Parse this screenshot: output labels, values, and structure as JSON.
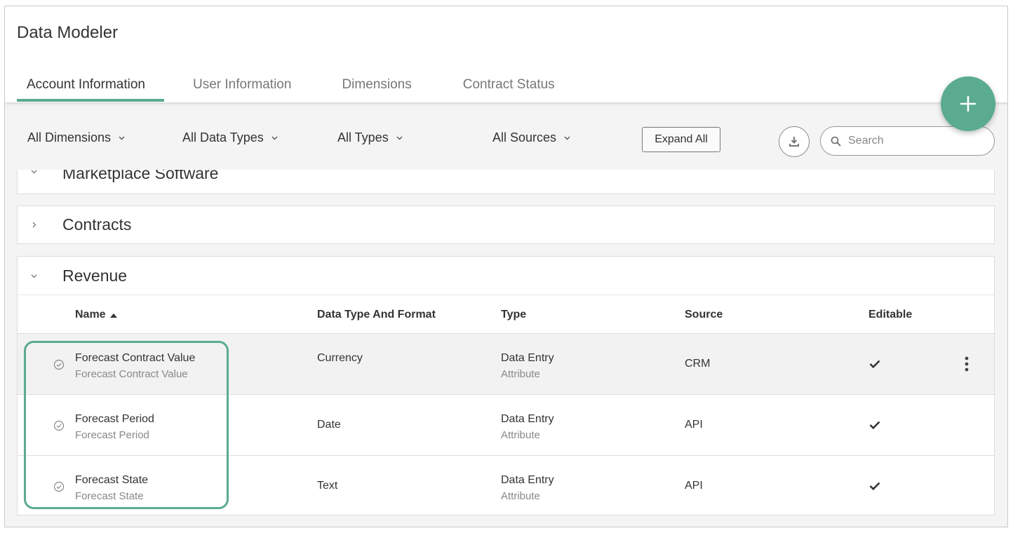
{
  "app": {
    "title": "Data Modeler"
  },
  "tabs": [
    {
      "label": "Account Information",
      "active": true
    },
    {
      "label": "User Information",
      "active": false
    },
    {
      "label": "Dimensions",
      "active": false
    },
    {
      "label": "Contract Status",
      "active": false
    }
  ],
  "fab": {
    "icon": "plus-icon"
  },
  "filters": {
    "dimensions": "All Dimensions",
    "data_types": "All Data Types",
    "types": "All Types",
    "sources": "All Sources",
    "expand_all": "Expand All",
    "download_icon": "download-icon",
    "search_placeholder": "Search"
  },
  "sections": {
    "marketplace": {
      "title": "Marketplace Software",
      "expanded": true
    },
    "contracts": {
      "title": "Contracts",
      "expanded": false
    },
    "revenue": {
      "title": "Revenue",
      "expanded": true
    }
  },
  "table": {
    "columns": {
      "name": "Name",
      "dtype": "Data Type And Format",
      "type": "Type",
      "source": "Source",
      "editable": "Editable"
    },
    "rows": [
      {
        "name": "Forecast Contract Value",
        "sub": "Forecast Contract Value",
        "dtype": "Currency",
        "type": "Data Entry",
        "type_sub": "Attribute",
        "source": "CRM",
        "editable": true
      },
      {
        "name": "Forecast Period",
        "sub": "Forecast Period",
        "dtype": "Date",
        "type": "Data Entry",
        "type_sub": "Attribute",
        "source": "API",
        "editable": true
      },
      {
        "name": "Forecast State",
        "sub": "Forecast State",
        "dtype": "Text",
        "type": "Data Entry",
        "type_sub": "Attribute",
        "source": "API",
        "editable": true
      }
    ]
  },
  "colors": {
    "accent": "#5aab8f",
    "background": "#f4f4f4",
    "highlight": "#5aab8f"
  }
}
